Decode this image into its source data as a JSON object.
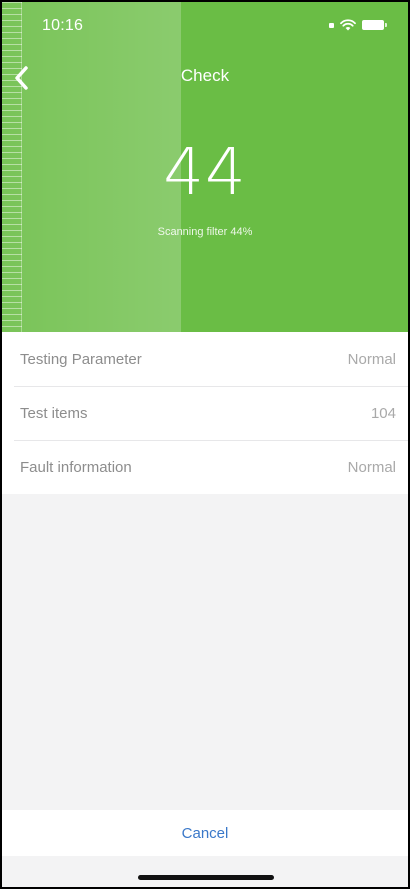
{
  "status_bar": {
    "time": "10:16",
    "icons": [
      "signal-icon",
      "wifi-icon",
      "battery-icon"
    ]
  },
  "header": {
    "title": "Check",
    "progress_value": "44",
    "progress_fraction": 0.44,
    "scan_text": "Scanning filter 44%",
    "color": "#6abd45"
  },
  "list": {
    "rows": [
      {
        "label": "Testing Parameter",
        "value": "Normal"
      },
      {
        "label": "Test items",
        "value": "104"
      },
      {
        "label": "Fault information",
        "value": "Normal"
      }
    ]
  },
  "footer": {
    "cancel_label": "Cancel",
    "accent": "#3a78c9"
  }
}
